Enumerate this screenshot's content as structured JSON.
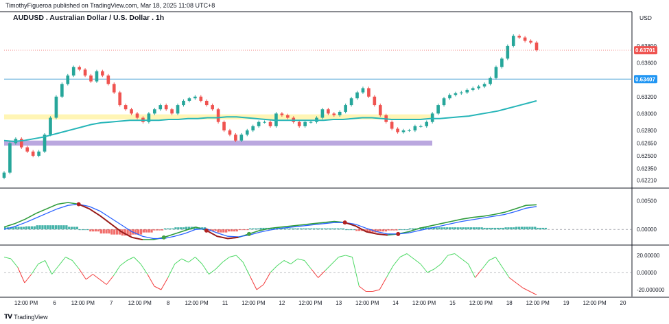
{
  "header": {
    "published": "TimothyFigueroa published on TradingView.com, Mar 18, 2025 11:08 UTC+8",
    "symbol": "AUDUSD . Australian Dollar / U.S. Dollar . 1h",
    "currency": "USD"
  },
  "footer": {
    "brand": "TradingView"
  },
  "colors": {
    "up": "#26a69a",
    "down": "#ef5350",
    "ema": "#26b5b8",
    "hline": "#4fa3d6",
    "zone_yellow": "#fff3a8",
    "zone_purple": "#b39ddb",
    "macd_green": "#2e9b3a",
    "macd_blue": "#2962ff",
    "macd_dark": "#9b1b1b",
    "osc_green": "#4cd964",
    "osc_red": "#f23b3b"
  },
  "chart_data": [
    {
      "type": "candlestick",
      "title": "AUDUSD . Australian Dollar / U.S. Dollar . 1h",
      "ylim": [
        0.6215,
        0.641
      ],
      "y_ticks": [
        "0.63800",
        "0.63600",
        "0.63200",
        "0.63000",
        "0.62800",
        "0.62650",
        "0.62500",
        "0.62350",
        "0.62210"
      ],
      "x_ticks": [
        "12:00 PM",
        "6",
        "12:00 PM",
        "7",
        "12:00 PM",
        "8",
        "12:00 PM",
        "11",
        "12:00 PM",
        "12",
        "12:00 PM",
        "13",
        "12:00 PM",
        "14",
        "12:00 PM",
        "15",
        "12:00 PM",
        "18",
        "12:00 PM",
        "19",
        "12:00 PM",
        "20"
      ],
      "last_price": "0.63701",
      "hline_price": "0.63407",
      "hline_value": 0.63407,
      "zones": [
        {
          "name": "yellow zone",
          "from": 0.6293,
          "to": 0.6299
        },
        {
          "name": "purple zone",
          "from": 0.6262,
          "to": 0.6268
        }
      ],
      "series": [
        {
          "name": "price",
          "values": [
            0.623,
            0.6265,
            0.627,
            0.626,
            0.6255,
            0.625,
            0.6255,
            0.6275,
            0.6295,
            0.632,
            0.6335,
            0.6345,
            0.6355,
            0.6352,
            0.6345,
            0.6338,
            0.635,
            0.6345,
            0.6335,
            0.6325,
            0.631,
            0.6305,
            0.63,
            0.6295,
            0.629,
            0.63,
            0.6305,
            0.631,
            0.6305,
            0.63,
            0.631,
            0.6315,
            0.6318,
            0.632,
            0.6315,
            0.631,
            0.6305,
            0.629,
            0.628,
            0.6275,
            0.6268,
            0.6275,
            0.628,
            0.6285,
            0.629,
            0.629,
            0.6285,
            0.63,
            0.6298,
            0.6295,
            0.629,
            0.6285,
            0.629,
            0.629,
            0.6295,
            0.6305,
            0.63,
            0.6298,
            0.6302,
            0.631,
            0.6318,
            0.6325,
            0.633,
            0.632,
            0.631,
            0.6298,
            0.629,
            0.6282,
            0.6278,
            0.628,
            0.628,
            0.6285,
            0.6285,
            0.629,
            0.63,
            0.631,
            0.6318,
            0.6322,
            0.6324,
            0.6325,
            0.6328,
            0.633,
            0.6332,
            0.6335,
            0.6342,
            0.6355,
            0.6365,
            0.638,
            0.6392,
            0.639,
            0.6386,
            0.6384,
            0.6375
          ]
        },
        {
          "name": "EMA",
          "values": [
            0.6268,
            0.6267,
            0.6268,
            0.627,
            0.6272,
            0.6275,
            0.6278,
            0.6281,
            0.6284,
            0.6287,
            0.6289,
            0.629,
            0.6291,
            0.6292,
            0.6292,
            0.6292,
            0.6292,
            0.6293,
            0.6293,
            0.6294,
            0.6294,
            0.6295,
            0.6295,
            0.6296,
            0.6296,
            0.6295,
            0.6294,
            0.6293,
            0.6292,
            0.6292,
            0.6292,
            0.6292,
            0.6292,
            0.6292,
            0.6293,
            0.6293,
            0.6294,
            0.6295,
            0.6295,
            0.6294,
            0.6293,
            0.6293,
            0.6293,
            0.6293,
            0.6294,
            0.6294,
            0.6295,
            0.6296,
            0.6297,
            0.6299,
            0.6301,
            0.6303,
            0.6306,
            0.6309,
            0.6312,
            0.6315
          ]
        }
      ]
    },
    {
      "type": "line",
      "name": "macd",
      "y_ticks": [
        "0.00500",
        "0.00000"
      ],
      "ylim": [
        -0.0025,
        0.0065
      ],
      "series": [
        {
          "name": "line-green",
          "values": [
            0.0004,
            0.001,
            0.0018,
            0.0028,
            0.0036,
            0.0044,
            0.0047,
            0.0044,
            0.0036,
            0.0024,
            0.001,
            -0.0004,
            -0.0014,
            -0.0018,
            -0.0018,
            -0.0014,
            -0.0008,
            -0.0002,
            0.0004,
            -0.0002,
            -0.0012,
            -0.0016,
            -0.0014,
            -0.0008,
            -0.0002,
            0.0002,
            0.0004,
            0.0006,
            0.0008,
            0.001,
            0.0012,
            0.0014,
            0.0012,
            0.0006,
            -0.0004,
            -0.0008,
            -0.001,
            -0.0008,
            -0.0004,
            0.0002,
            0.0006,
            0.001,
            0.0014,
            0.0018,
            0.0021,
            0.0023,
            0.0026,
            0.003,
            0.0036,
            0.0042,
            0.0043
          ]
        },
        {
          "name": "line-blue",
          "values": [
            0.0,
            0.0005,
            0.0012,
            0.002,
            0.0028,
            0.0036,
            0.0042,
            0.0044,
            0.004,
            0.0032,
            0.002,
            0.0008,
            -0.0004,
            -0.0012,
            -0.0016,
            -0.0016,
            -0.0012,
            -0.0007,
            0.0,
            0.0001,
            -0.0006,
            -0.0012,
            -0.0013,
            -0.001,
            -0.0005,
            -0.0001,
            0.0002,
            0.0004,
            0.0006,
            0.0008,
            0.001,
            0.0012,
            0.0012,
            0.0009,
            0.0002,
            -0.0004,
            -0.0008,
            -0.0008,
            -0.0006,
            -0.0002,
            0.0002,
            0.0006,
            0.001,
            0.0014,
            0.0017,
            0.002,
            0.0023,
            0.0026,
            0.0031,
            0.0037,
            0.004
          ]
        },
        {
          "name": "line-dark-red",
          "values": [
            null,
            null,
            null,
            null,
            null,
            null,
            null,
            0.0044,
            0.0036,
            0.0024,
            0.001,
            -0.0004,
            -0.0014,
            -0.0018,
            null,
            null,
            null,
            null,
            null,
            -0.0002,
            -0.0012,
            -0.0016,
            -0.0014,
            null,
            null,
            null,
            null,
            null,
            null,
            null,
            null,
            null,
            0.0012,
            0.0006,
            -0.0004,
            -0.0008,
            -0.001,
            null
          ]
        }
      ]
    },
    {
      "type": "line",
      "name": "oscillator",
      "y_ticks": [
        "20.00000",
        "0.00000",
        "-20.000000"
      ],
      "ylim": [
        -28,
        28
      ],
      "series": [
        {
          "name": "osc",
          "values": [
            18,
            16,
            6,
            -12,
            -2,
            10,
            14,
            -2,
            8,
            18,
            14,
            4,
            -8,
            -2,
            -8,
            -14,
            -4,
            8,
            14,
            18,
            10,
            -2,
            -16,
            -20,
            -6,
            10,
            16,
            12,
            18,
            10,
            -2,
            4,
            12,
            18,
            20,
            12,
            -4,
            -20,
            -14,
            0,
            8,
            14,
            10,
            16,
            14,
            4,
            -6,
            2,
            10,
            18,
            20,
            18,
            -16,
            -22,
            -22,
            -20,
            -6,
            8,
            18,
            22,
            16,
            10,
            0,
            4,
            10,
            20,
            22,
            16,
            10,
            -6,
            4,
            14,
            18,
            6,
            -6,
            -12,
            -18,
            -22,
            -26
          ]
        }
      ]
    }
  ]
}
